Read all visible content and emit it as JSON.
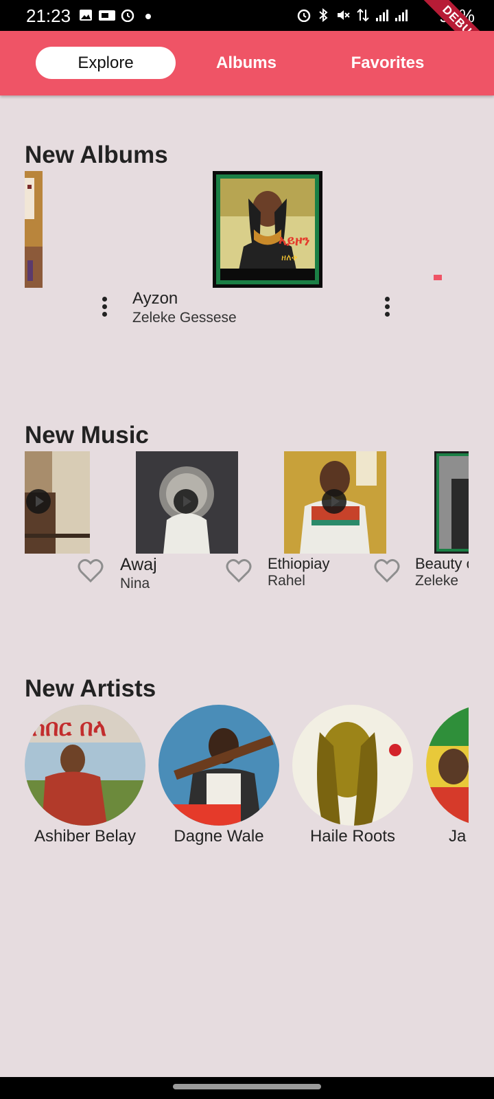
{
  "status_bar": {
    "time": "21:23",
    "battery": "93%",
    "icons": [
      "gallery-icon",
      "cast-icon",
      "alarm-icon",
      "dot-icon",
      "alarm-icon",
      "bluetooth-icon",
      "mute-icon",
      "data-icon",
      "signal-icon",
      "signal-icon",
      "battery-icon"
    ]
  },
  "debug_ribbon": "DEBUG",
  "tabs": [
    {
      "label": "Explore",
      "active": true
    },
    {
      "label": "Albums",
      "active": false
    },
    {
      "label": "Favorites",
      "active": false
    }
  ],
  "sections": {
    "albums_title": "New Albums",
    "music_title": "New Music",
    "artists_title": "New Artists"
  },
  "albums": [
    {
      "title": "Ayzon",
      "artist": "Zeleke Gessese"
    }
  ],
  "music": [
    {
      "title": "Awaj",
      "artist": "Nina"
    },
    {
      "title": "Ethiopiay",
      "artist": "Rahel"
    },
    {
      "title": "Beauty o",
      "artist": "Zeleke"
    }
  ],
  "artists": [
    {
      "name": "Ashiber Belay"
    },
    {
      "name": "Dagne Wale"
    },
    {
      "name": "Haile Roots"
    },
    {
      "name": "Ja"
    }
  ],
  "colors": {
    "accent": "#ef5466",
    "background": "#e6dcdf"
  }
}
